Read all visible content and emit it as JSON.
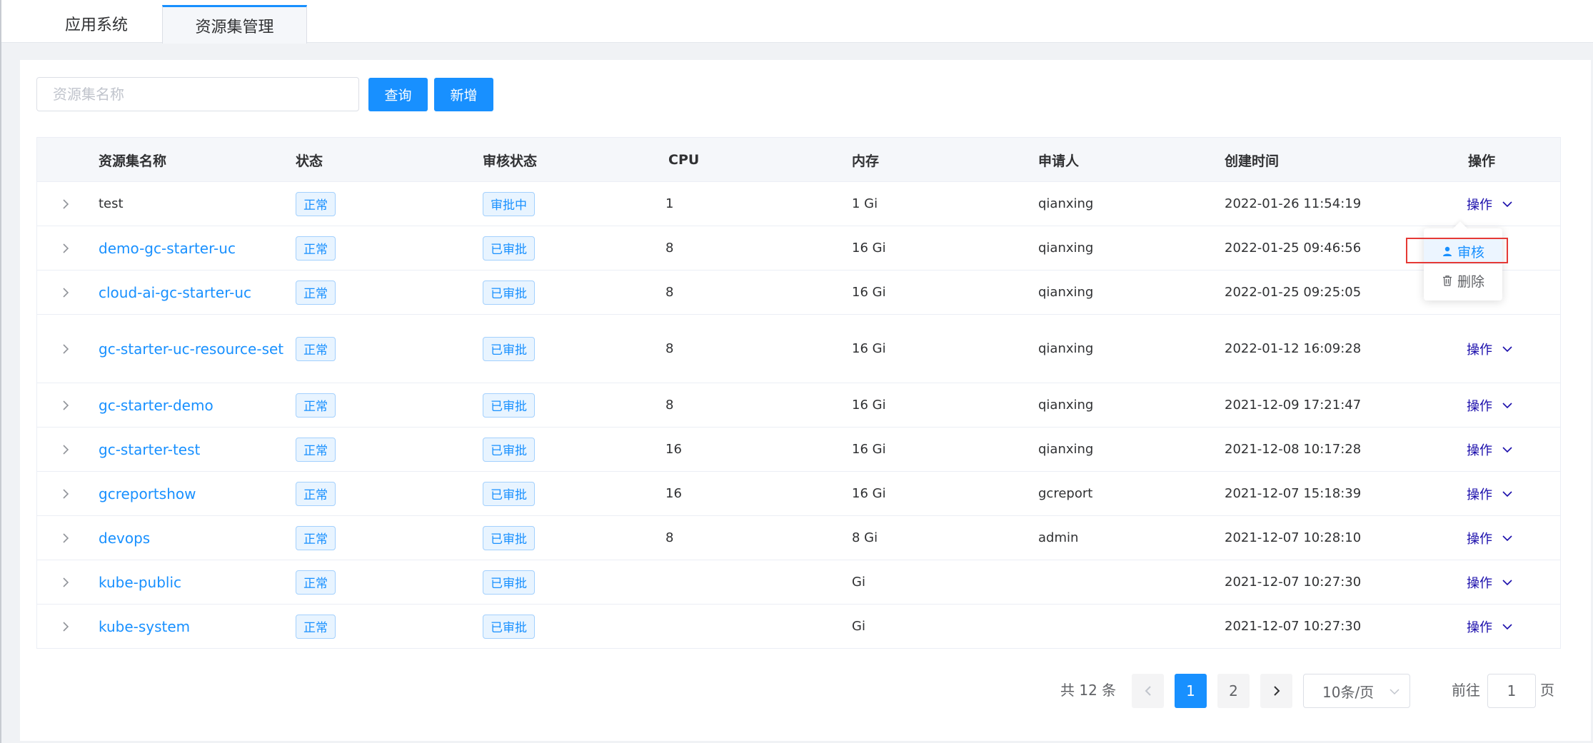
{
  "tabs": [
    {
      "label": "应用系统",
      "active": false
    },
    {
      "label": "资源集管理",
      "active": true
    }
  ],
  "search": {
    "placeholder": "资源集名称"
  },
  "buttons": {
    "query": "查询",
    "add": "新增"
  },
  "table": {
    "headers": {
      "name": "资源集名称",
      "status": "状态",
      "audit": "审核状态",
      "cpu": "CPU",
      "memory": "内存",
      "applicant": "申请人",
      "created": "创建时间",
      "operation": "操作"
    },
    "rows": [
      {
        "name": "test",
        "status": "正常",
        "audit": "审批中",
        "cpu": "1",
        "memory": "1 Gi",
        "applicant": "qianxing",
        "created": "2022-01-26 11:54:19",
        "op": "操作"
      },
      {
        "name": "demo-gc-starter-uc",
        "status": "正常",
        "audit": "已审批",
        "cpu": "8",
        "memory": "16 Gi",
        "applicant": "qianxing",
        "created": "2022-01-25 09:46:56",
        "op": ""
      },
      {
        "name": "cloud-ai-gc-starter-uc",
        "status": "正常",
        "audit": "已审批",
        "cpu": "8",
        "memory": "16 Gi",
        "applicant": "qianxing",
        "created": "2022-01-25 09:25:05",
        "op": ""
      },
      {
        "name": "gc-starter-uc-resource-set",
        "status": "正常",
        "audit": "已审批",
        "cpu": "8",
        "memory": "16 Gi",
        "applicant": "qianxing",
        "created": "2022-01-12 16:09:28",
        "op": "操作"
      },
      {
        "name": "gc-starter-demo",
        "status": "正常",
        "audit": "已审批",
        "cpu": "8",
        "memory": "16 Gi",
        "applicant": "qianxing",
        "created": "2021-12-09 17:21:47",
        "op": "操作"
      },
      {
        "name": "gc-starter-test",
        "status": "正常",
        "audit": "已审批",
        "cpu": "16",
        "memory": "16 Gi",
        "applicant": "qianxing",
        "created": "2021-12-08 10:17:28",
        "op": "操作"
      },
      {
        "name": "gcreportshow",
        "status": "正常",
        "audit": "已审批",
        "cpu": "16",
        "memory": "16 Gi",
        "applicant": "gcreport",
        "created": "2021-12-07 15:18:39",
        "op": "操作"
      },
      {
        "name": "devops",
        "status": "正常",
        "audit": "已审批",
        "cpu": "8",
        "memory": "8 Gi",
        "applicant": "admin",
        "created": "2021-12-07 10:28:10",
        "op": "操作"
      },
      {
        "name": "kube-public",
        "status": "正常",
        "audit": "已审批",
        "cpu": "",
        "memory": "Gi",
        "applicant": "",
        "created": "2021-12-07 10:27:30",
        "op": "操作"
      },
      {
        "name": "kube-system",
        "status": "正常",
        "audit": "已审批",
        "cpu": "",
        "memory": "Gi",
        "applicant": "",
        "created": "2021-12-07 10:27:30",
        "op": "操作"
      }
    ]
  },
  "dropdown": {
    "approve": "审核",
    "delete": "删除"
  },
  "pagination": {
    "total": "共 12 条",
    "pages": [
      "1",
      "2"
    ],
    "current": "1",
    "page_size": "10条/页",
    "goto_prefix": "前往",
    "goto_value": "1",
    "goto_suffix": "页"
  },
  "colors": {
    "primary": "#1890ff",
    "op_link": "#1a0dab",
    "highlight": "#e53935"
  }
}
